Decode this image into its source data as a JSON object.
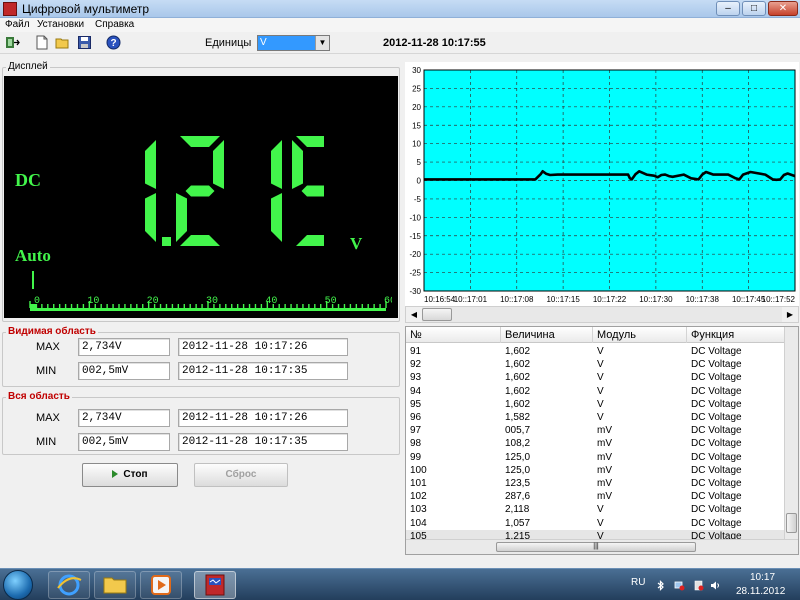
{
  "window": {
    "title": "Цифровой мультиметр"
  },
  "menu": {
    "items": [
      "Файл",
      "Установки",
      "Справка"
    ]
  },
  "toolbar": {
    "units_label": "Единицы",
    "units_value": "V",
    "datetime": "2012-11-28 10:17:55"
  },
  "display": {
    "group_title": "Дисплей",
    "reading": "1.215",
    "mode": "DC",
    "range_mode": "Auto",
    "unit": "V",
    "scale_labels": [
      "0",
      "10",
      "20",
      "30",
      "40",
      "50",
      "60"
    ],
    "bar_fraction": 0.02
  },
  "visible_area": {
    "title": "Видимая область",
    "max_label": "MAX",
    "max_value": "2,734V",
    "max_time": "2012-11-28 10:17:26",
    "min_label": "MIN",
    "min_value": "002,5mV",
    "min_time": "2012-11-28 10:17:35"
  },
  "total_area": {
    "title": "Вся область",
    "max_label": "MAX",
    "max_value": "2,734V",
    "max_time": "2012-11-28 10:17:26",
    "min_label": "MIN",
    "min_value": "002,5mV",
    "min_time": "2012-11-28 10:17:35"
  },
  "buttons": {
    "stop": "Стоп",
    "reset": "Сброс"
  },
  "chart_data": {
    "type": "line",
    "title": "",
    "xlabel": "",
    "ylabel": "",
    "ylim": [
      -30,
      30
    ],
    "yticks": [
      30,
      25,
      20,
      15,
      10,
      5,
      0,
      -5,
      -10,
      -15,
      -20,
      -25,
      -30
    ],
    "xticks": [
      "10:16:54",
      "10::17:01",
      "10::17:08",
      "10::17:15",
      "10::17:22",
      "10::17:30",
      "10::17:38",
      "10::17:45",
      "10::17:52"
    ],
    "grid": true,
    "background": "#00ffff",
    "line_color": "#000000",
    "x": [
      0,
      0.2,
      0.3,
      0.315,
      0.32,
      0.33,
      0.34,
      0.36,
      0.5,
      0.55,
      0.555,
      0.56,
      0.57,
      0.58,
      0.6,
      0.62,
      0.63,
      0.64,
      0.65,
      0.66,
      0.67,
      0.7,
      0.72,
      0.74,
      0.75,
      0.76,
      0.78,
      0.82,
      0.84,
      0.85,
      0.86,
      0.88,
      0.92,
      0.94,
      0.95,
      0.96,
      0.97,
      0.98,
      1.0
    ],
    "y": [
      0.3,
      0.3,
      0.3,
      1.8,
      2.5,
      1.8,
      1.5,
      1.6,
      1.6,
      1.6,
      0.6,
      0.3,
      1.7,
      2.5,
      1.6,
      1.3,
      0.9,
      1.5,
      1.6,
      1.2,
      1.0,
      1.6,
      0.6,
      0.3,
      1.6,
      2.3,
      1.6,
      1.6,
      0.6,
      0.3,
      1.6,
      2.3,
      1.6,
      0.3,
      0.2,
      0.3,
      1.5,
      1.9,
      1.2
    ]
  },
  "table": {
    "headers": [
      "№",
      "Величина",
      "Модуль",
      "Функция"
    ],
    "rows": [
      [
        "91",
        "1,602",
        "V",
        "DC Voltage"
      ],
      [
        "92",
        "1,602",
        "V",
        "DC Voltage"
      ],
      [
        "93",
        "1,602",
        "V",
        "DC Voltage"
      ],
      [
        "94",
        "1,602",
        "V",
        "DC Voltage"
      ],
      [
        "95",
        "1,602",
        "V",
        "DC Voltage"
      ],
      [
        "96",
        "1,582",
        "V",
        "DC Voltage"
      ],
      [
        "97",
        "005,7",
        "mV",
        "DC Voltage"
      ],
      [
        "98",
        "108,2",
        "mV",
        "DC Voltage"
      ],
      [
        "99",
        "125,0",
        "mV",
        "DC Voltage"
      ],
      [
        "100",
        "125,0",
        "mV",
        "DC Voltage"
      ],
      [
        "101",
        "123,5",
        "mV",
        "DC Voltage"
      ],
      [
        "102",
        "287,6",
        "mV",
        "DC Voltage"
      ],
      [
        "103",
        "2,118",
        "V",
        "DC Voltage"
      ],
      [
        "104",
        "1,057",
        "V",
        "DC Voltage"
      ],
      [
        "105",
        "1,215",
        "V",
        "DC Voltage"
      ]
    ],
    "selected_row": 14
  },
  "taskbar": {
    "language": "RU",
    "time": "10:17",
    "date": "28.11.2012"
  },
  "colors": {
    "segment": "#42f54b",
    "accent_red": "#c00000",
    "chart_bg": "#00ffff"
  }
}
